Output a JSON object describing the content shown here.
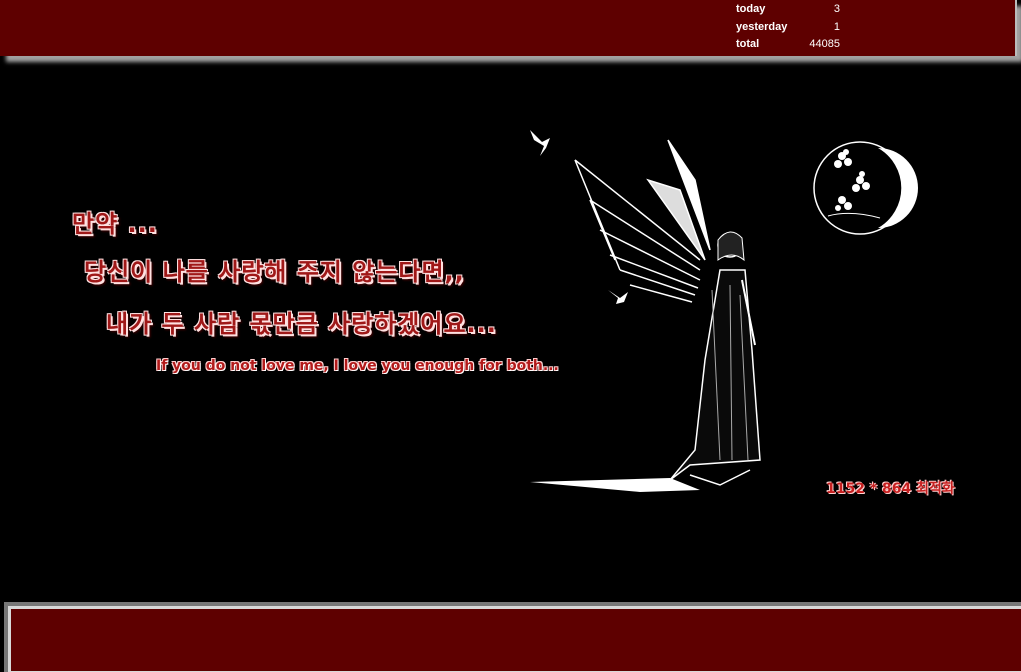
{
  "counter": {
    "rows": [
      {
        "label": "today",
        "value": "3"
      },
      {
        "label": "yesterday",
        "value": "1"
      },
      {
        "label": "total",
        "value": "44085"
      }
    ]
  },
  "message": {
    "line1": "만약 ...",
    "line2": "당신이 나를 사랑해 주지 않는다면,,",
    "line3": "내가 두 사람 몫만큼 사랑하겠어요...",
    "english": "If you do not love me,  I love you enough for both..."
  },
  "resolution_note": "1152 * 864 최적화",
  "colors": {
    "bar": "#5e0000",
    "background": "#000000",
    "text_red": "#a01818"
  },
  "icons": [
    "angel-illustration",
    "bird-icon",
    "moon-flower-emblem"
  ]
}
